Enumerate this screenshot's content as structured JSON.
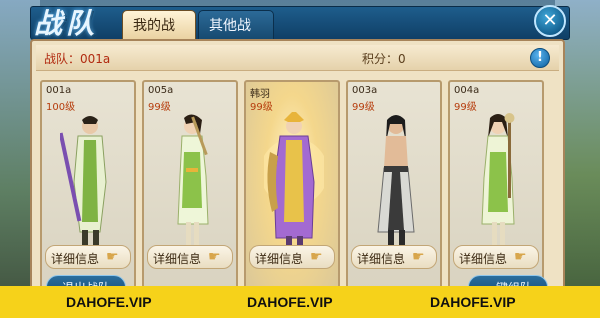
{
  "header": {
    "logo_text": "战队",
    "tabs": [
      {
        "label": "我的战队",
        "active": true
      },
      {
        "label": "其他战队",
        "active": false
      }
    ],
    "close_symbol": "✕"
  },
  "info_bar": {
    "team": "战队：001a",
    "score": "积分：0",
    "info_symbol": "!"
  },
  "heroes": [
    {
      "name": "001a",
      "level": "100级",
      "detail_label": "详细信息",
      "robe": "#e8f0d0",
      "accent": "#7fb343"
    },
    {
      "name": "005a",
      "level": "99级",
      "detail_label": "详细信息",
      "robe": "#eef6d8",
      "accent": "#8cc24a"
    },
    {
      "name": "韩羽",
      "level": "99级",
      "detail_label": "详细信息",
      "robe": "#a36ad1",
      "accent": "#e8c24a"
    },
    {
      "name": "003a",
      "level": "99级",
      "detail_label": "详细信息",
      "robe": "#d9d9d4",
      "accent": "#3a3a3a"
    },
    {
      "name": "004a",
      "level": "99级",
      "detail_label": "详细信息",
      "robe": "#eef4d6",
      "accent": "#8cc24a"
    }
  ],
  "bottom_buttons": {
    "left": "退出战队",
    "right": "一键组队"
  },
  "watermark": [
    "DAHOFE.VIP",
    "DAHOFE.VIP",
    "DAHOFE.VIP"
  ]
}
